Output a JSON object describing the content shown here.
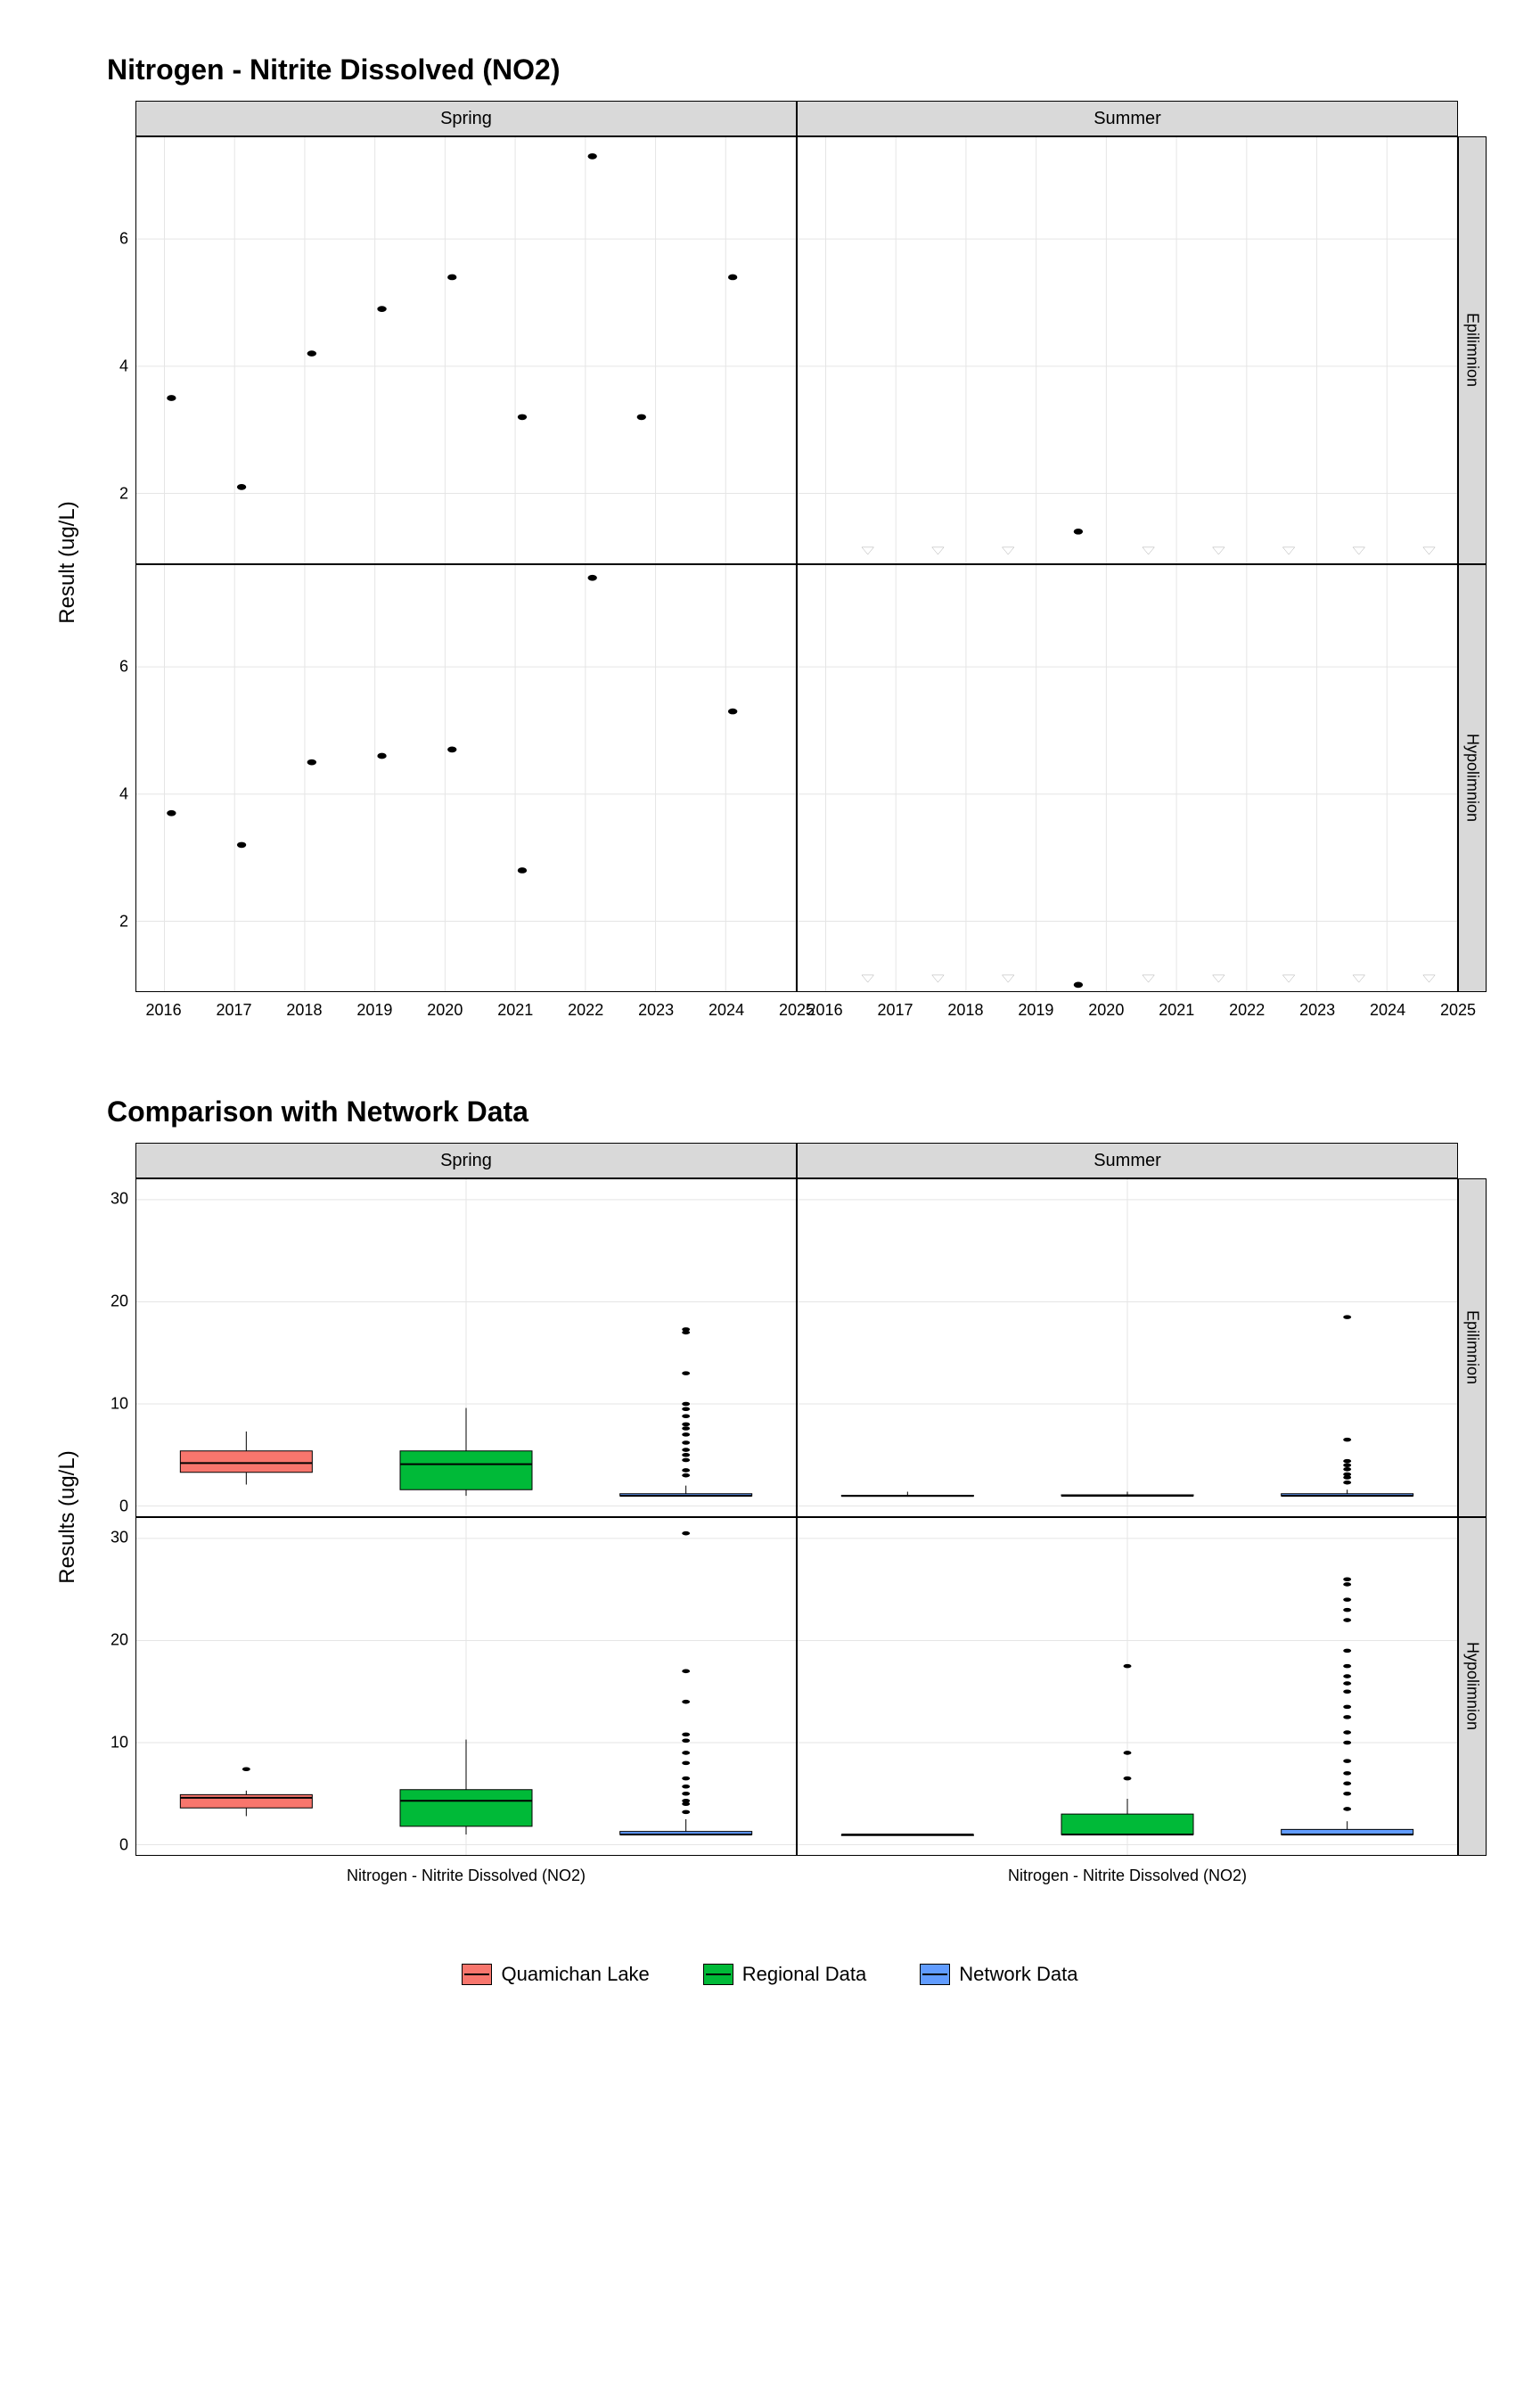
{
  "chart_data": [
    {
      "type": "scatter",
      "title": "Nitrogen - Nitrite Dissolved (NO2)",
      "ylabel": "Result (ug/L)",
      "xlabel": "",
      "x_ticks": [
        2016,
        2017,
        2018,
        2019,
        2020,
        2021,
        2022,
        2023,
        2024,
        2025
      ],
      "y_ticks": [
        2,
        4,
        6
      ],
      "ylim": [
        0.9,
        7.6
      ],
      "xlim": [
        2015.6,
        2025
      ],
      "col_facets": [
        "Spring",
        "Summer"
      ],
      "row_facets": [
        "Epilimnion",
        "Hypolimnion"
      ],
      "panels": {
        "Spring|Epilimnion": {
          "points": [
            {
              "x": 2016.1,
              "y": 3.5
            },
            {
              "x": 2017.1,
              "y": 2.1
            },
            {
              "x": 2018.1,
              "y": 4.2
            },
            {
              "x": 2019.1,
              "y": 4.9
            },
            {
              "x": 2020.1,
              "y": 5.4
            },
            {
              "x": 2021.1,
              "y": 3.2
            },
            {
              "x": 2022.1,
              "y": 7.3
            },
            {
              "x": 2022.8,
              "y": 3.2
            },
            {
              "x": 2024.1,
              "y": 5.4
            }
          ],
          "bdl": []
        },
        "Summer|Epilimnion": {
          "points": [
            {
              "x": 2019.6,
              "y": 1.4
            }
          ],
          "bdl": [
            2016.6,
            2017.6,
            2018.6,
            2020.6,
            2021.6,
            2022.6,
            2023.6,
            2024.6
          ]
        },
        "Spring|Hypolimnion": {
          "points": [
            {
              "x": 2016.1,
              "y": 3.7
            },
            {
              "x": 2017.1,
              "y": 3.2
            },
            {
              "x": 2018.1,
              "y": 4.5
            },
            {
              "x": 2019.1,
              "y": 4.6
            },
            {
              "x": 2020.1,
              "y": 4.7
            },
            {
              "x": 2021.1,
              "y": 2.8
            },
            {
              "x": 2022.1,
              "y": 7.4
            },
            {
              "x": 2024.1,
              "y": 5.3
            }
          ],
          "bdl": []
        },
        "Summer|Hypolimnion": {
          "points": [
            {
              "x": 2019.6,
              "y": 1.0
            }
          ],
          "bdl": [
            2016.6,
            2017.6,
            2018.6,
            2020.6,
            2021.6,
            2022.6,
            2023.6,
            2024.6
          ]
        }
      }
    },
    {
      "type": "boxplot",
      "title": "Comparison with Network Data",
      "ylabel": "Results (ug/L)",
      "xlabel": "Nitrogen - Nitrite Dissolved (NO2)",
      "y_ticks": [
        0,
        10,
        20,
        30
      ],
      "ylim": [
        -1,
        32
      ],
      "col_facets": [
        "Spring",
        "Summer"
      ],
      "row_facets": [
        "Epilimnion",
        "Hypolimnion"
      ],
      "series": [
        {
          "name": "Quamichan Lake",
          "color": "#f8766d"
        },
        {
          "name": "Regional Data",
          "color": "#00ba38"
        },
        {
          "name": "Network Data",
          "color": "#619cff"
        }
      ],
      "panels": {
        "Spring|Epilimnion": {
          "boxes": [
            {
              "series": "Quamichan Lake",
              "min": 2.1,
              "q1": 3.3,
              "median": 4.2,
              "q3": 5.4,
              "max": 7.3,
              "outliers": []
            },
            {
              "series": "Regional Data",
              "min": 1.0,
              "q1": 1.6,
              "median": 4.1,
              "q3": 5.4,
              "max": 9.6,
              "outliers": []
            },
            {
              "series": "Network Data",
              "min": 1.0,
              "q1": 1.0,
              "median": 1.0,
              "q3": 1.2,
              "max": 2.0,
              "outliers": [
                3.0,
                3.5,
                4.5,
                5.0,
                5.5,
                6.2,
                7.0,
                7.6,
                8.0,
                8.8,
                9.5,
                10.0,
                13.0,
                17.0,
                17.3
              ]
            }
          ]
        },
        "Summer|Epilimnion": {
          "boxes": [
            {
              "series": "Quamichan Lake",
              "min": 1.0,
              "q1": 1.0,
              "median": 1.0,
              "q3": 1.05,
              "max": 1.4,
              "outliers": []
            },
            {
              "series": "Regional Data",
              "min": 1.0,
              "q1": 1.0,
              "median": 1.0,
              "q3": 1.1,
              "max": 1.4,
              "outliers": []
            },
            {
              "series": "Network Data",
              "min": 1.0,
              "q1": 1.0,
              "median": 1.0,
              "q3": 1.2,
              "max": 1.6,
              "outliers": [
                2.3,
                2.8,
                3.1,
                3.6,
                4.0,
                4.4,
                6.5,
                18.5
              ]
            }
          ]
        },
        "Spring|Hypolimnion": {
          "boxes": [
            {
              "series": "Quamichan Lake",
              "min": 2.8,
              "q1": 3.6,
              "median": 4.6,
              "q3": 4.9,
              "max": 5.3,
              "outliers": [
                7.4
              ]
            },
            {
              "series": "Regional Data",
              "min": 1.0,
              "q1": 1.8,
              "median": 4.3,
              "q3": 5.4,
              "max": 10.3,
              "outliers": []
            },
            {
              "series": "Network Data",
              "min": 1.0,
              "q1": 1.0,
              "median": 1.0,
              "q3": 1.3,
              "max": 2.5,
              "outliers": [
                3.2,
                4.0,
                4.3,
                5.0,
                5.7,
                6.5,
                8.0,
                9.0,
                10.2,
                10.8,
                14.0,
                17.0,
                30.5
              ]
            }
          ]
        },
        "Summer|Hypolimnion": {
          "boxes": [
            {
              "series": "Quamichan Lake",
              "min": 1.0,
              "q1": 1.0,
              "median": 1.0,
              "q3": 1.0,
              "max": 1.0,
              "outliers": []
            },
            {
              "series": "Regional Data",
              "min": 1.0,
              "q1": 1.0,
              "median": 1.0,
              "q3": 3.0,
              "max": 4.5,
              "outliers": [
                6.5,
                9.0,
                17.5
              ]
            },
            {
              "series": "Network Data",
              "min": 1.0,
              "q1": 1.0,
              "median": 1.0,
              "q3": 1.5,
              "max": 2.3,
              "outliers": [
                3.5,
                5.0,
                6.0,
                7.0,
                8.2,
                10.0,
                11.0,
                12.5,
                13.5,
                15.0,
                15.8,
                16.5,
                17.5,
                19.0,
                22.0,
                23.0,
                24.0,
                25.5,
                26.0
              ]
            }
          ]
        }
      }
    }
  ],
  "legend": {
    "items": [
      "Quamichan Lake",
      "Regional Data",
      "Network Data"
    ]
  }
}
